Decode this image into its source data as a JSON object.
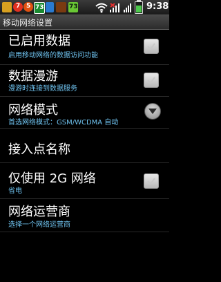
{
  "status_bar": {
    "notifications": [
      {
        "icon": "app-notification-icon",
        "number": ""
      },
      {
        "icon": "badge-icon",
        "number": "7"
      },
      {
        "icon": "badge-icon",
        "number": "5"
      },
      {
        "icon": "app-icon",
        "number": "73"
      },
      {
        "icon": "app-icon",
        "number": ""
      },
      {
        "icon": "app-icon",
        "number": ""
      },
      {
        "icon": "battery-notification-icon",
        "number": "73"
      }
    ],
    "time": "9:38"
  },
  "title_bar": {
    "title": "移动网络设置"
  },
  "settings": [
    {
      "title": "已启用数据",
      "summary": "启用移动网络的数据访问功能",
      "control": "checkbox",
      "checked": true
    },
    {
      "title": "数据漫游",
      "summary": "漫游时连接到数据服务",
      "control": "checkbox",
      "checked": true
    },
    {
      "title": "网络模式",
      "summary": "首选网络模式：GSM/WCDMA 自动",
      "control": "dropdown"
    },
    {
      "title": "接入点名称",
      "summary": "",
      "control": "none"
    },
    {
      "title": "仅使用 2G 网络",
      "summary": "省电",
      "control": "checkbox",
      "checked": true
    },
    {
      "title": "网络运营商",
      "summary": "选择一个网络运营商",
      "control": "none"
    }
  ],
  "colors": {
    "summary_text": "#6fc3f0",
    "background": "#000000"
  }
}
